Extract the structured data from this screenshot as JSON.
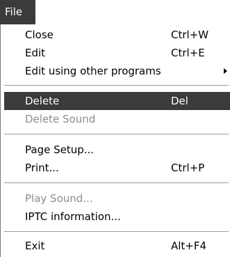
{
  "menubar": {
    "title": "File"
  },
  "menu": {
    "close": {
      "label": "Close",
      "shortcut": "Ctrl+W"
    },
    "edit": {
      "label": "Edit",
      "shortcut": "Ctrl+E"
    },
    "edit_other": {
      "label": "Edit using other programs"
    },
    "delete": {
      "label": "Delete",
      "shortcut": "Del"
    },
    "delete_sound": {
      "label": "Delete Sound"
    },
    "page_setup": {
      "label": "Page Setup..."
    },
    "print": {
      "label": "Print...",
      "shortcut": "Ctrl+P"
    },
    "play_sound": {
      "label": "Play Sound..."
    },
    "iptc": {
      "label": "IPTC information..."
    },
    "exit": {
      "label": "Exit",
      "shortcut": "Alt+F4"
    }
  },
  "colors": {
    "highlight": "#3b3b3b",
    "disabled_text": "#8c8c8c"
  }
}
